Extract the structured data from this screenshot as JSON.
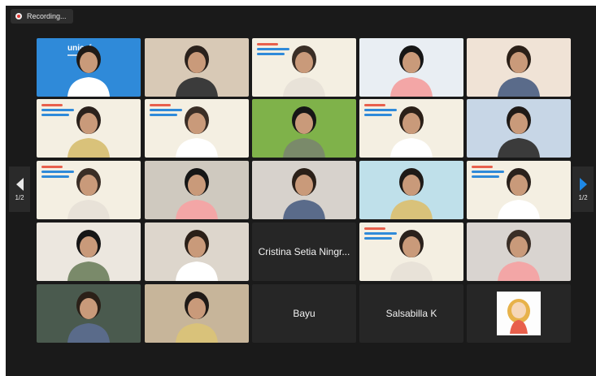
{
  "recording": {
    "label": "Recording..."
  },
  "navigation": {
    "prev_page": "1/2",
    "next_page": "1/2"
  },
  "colors": {
    "accent_blue": "#1e88e5",
    "active_speaker_border": "#35c435",
    "recording_red": "#e53935",
    "tile_background": "#262626"
  },
  "grid": {
    "rows": [
      [
        {
          "type": "video",
          "logo": "unicef"
        },
        {
          "type": "video"
        },
        {
          "type": "video"
        },
        {
          "type": "video",
          "active_speaker": true
        },
        {
          "type": "video"
        }
      ],
      [
        {
          "type": "video"
        },
        {
          "type": "video"
        },
        {
          "type": "video"
        },
        {
          "type": "video"
        },
        {
          "type": "video"
        }
      ],
      [
        {
          "type": "video"
        },
        {
          "type": "video"
        },
        {
          "type": "video"
        },
        {
          "type": "video"
        },
        {
          "type": "video"
        }
      ],
      [
        {
          "type": "video"
        },
        {
          "type": "video"
        },
        {
          "type": "name",
          "name": "Cristina Setia Ningr..."
        },
        {
          "type": "video"
        },
        {
          "type": "video"
        }
      ],
      [
        {
          "type": "video"
        },
        {
          "type": "video"
        },
        {
          "type": "name",
          "name": "Bayu"
        },
        {
          "type": "name",
          "name": "Salsabilla K"
        },
        {
          "type": "avatar"
        }
      ]
    ]
  }
}
